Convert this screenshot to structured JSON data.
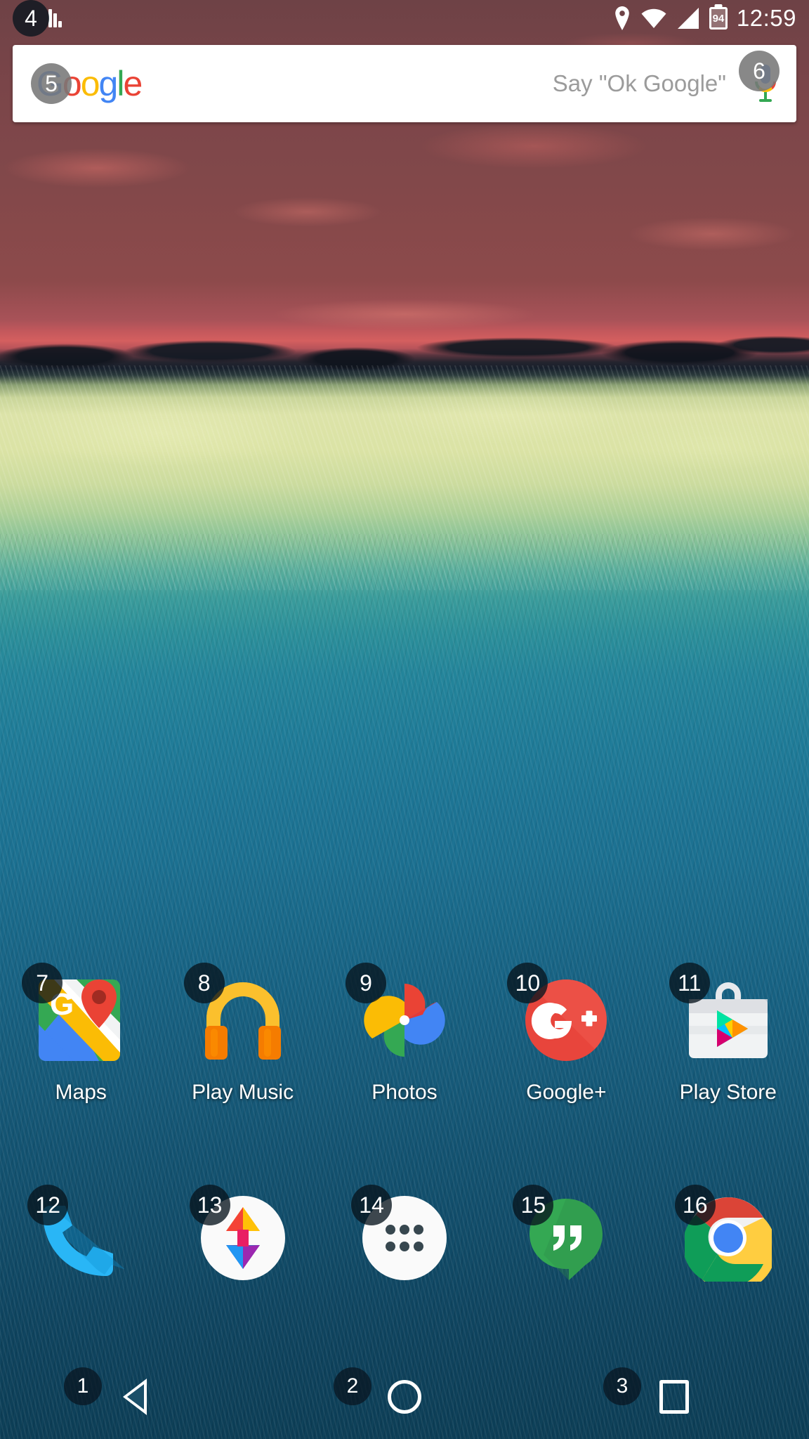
{
  "status_bar": {
    "volume_icon": "volume-bars-icon",
    "left_badge": "4",
    "icons": [
      "location-pin-icon",
      "wifi-icon",
      "cell-signal-icon",
      "battery-icon"
    ],
    "battery_level": "94",
    "time": "12:59"
  },
  "search": {
    "logo": "Google",
    "logo_letters": [
      "G",
      "o",
      "o",
      "g",
      "l",
      "e"
    ],
    "placeholder": "Say \"Ok Google\"",
    "mic_icon": "microphone-icon",
    "logo_badge": "5",
    "mic_badge": "6"
  },
  "apps": [
    {
      "label": "Maps",
      "icon": "google-maps-icon",
      "badge": "7"
    },
    {
      "label": "Play Music",
      "icon": "play-music-icon",
      "badge": "8"
    },
    {
      "label": "Photos",
      "icon": "google-photos-icon",
      "badge": "9"
    },
    {
      "label": "Google+",
      "icon": "google-plus-icon",
      "badge": "10"
    },
    {
      "label": "Play Store",
      "icon": "play-store-icon",
      "badge": "11"
    }
  ],
  "dock": [
    {
      "label": "Phone",
      "icon": "phone-icon",
      "badge": "12"
    },
    {
      "label": "Nova",
      "icon": "nova-launcher-icon",
      "badge": "13"
    },
    {
      "label": "All Apps",
      "icon": "app-drawer-icon",
      "badge": "14"
    },
    {
      "label": "Hangouts",
      "icon": "hangouts-icon",
      "badge": "15"
    },
    {
      "label": "Chrome",
      "icon": "chrome-icon",
      "badge": "16"
    }
  ],
  "nav_bar": [
    {
      "name": "back",
      "icon": "back-triangle-icon",
      "badge": "1"
    },
    {
      "name": "home",
      "icon": "home-circle-icon",
      "badge": "2"
    },
    {
      "name": "recents",
      "icon": "recents-square-icon",
      "badge": "3"
    }
  ],
  "colors": {
    "google_blue": "#4285F4",
    "google_red": "#EA4335",
    "google_yellow": "#FBBC05",
    "google_green": "#34A853",
    "badge_dark": "#08141E",
    "badge_light": "#787878"
  }
}
